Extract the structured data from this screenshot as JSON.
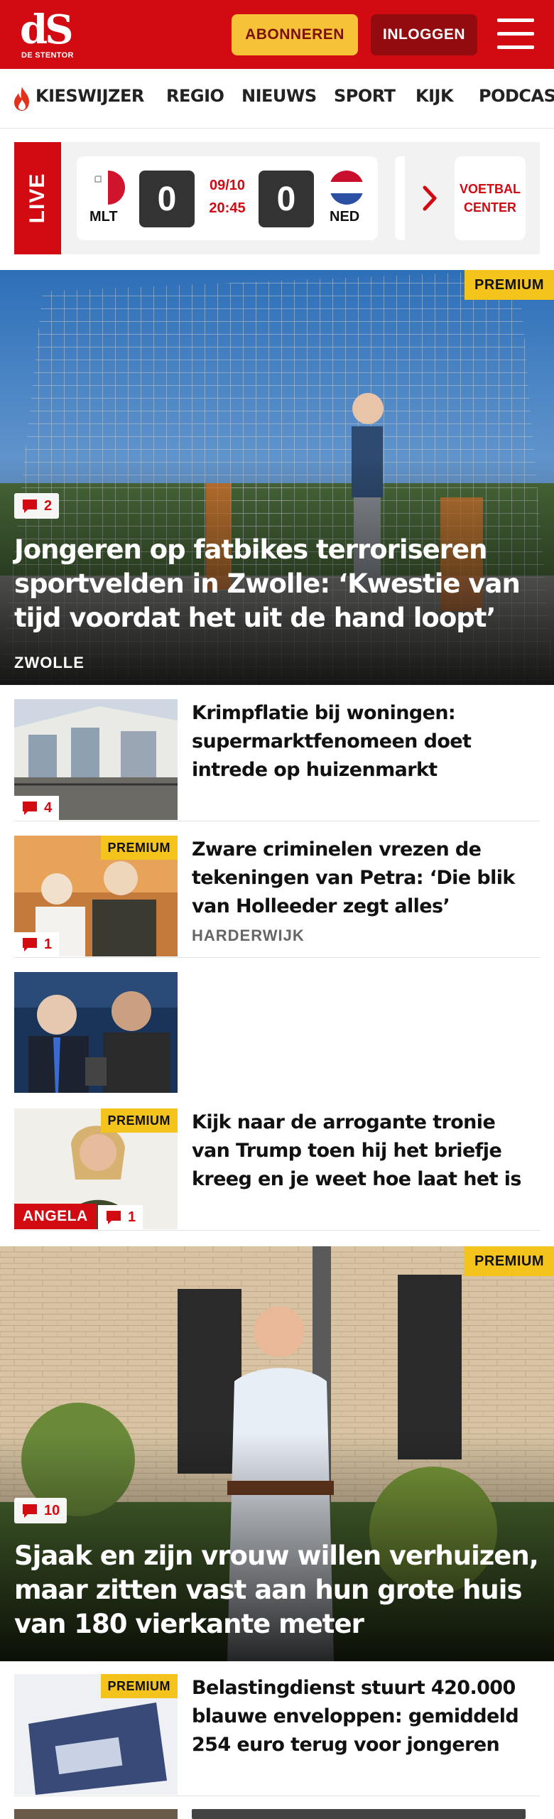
{
  "header": {
    "logo_text": "dS",
    "logo_subtitle": "DE STENTOR",
    "subscribe_label": "ABONNEREN",
    "login_label": "INLOGGEN",
    "menu_icon": "hamburger-menu-icon"
  },
  "nav": {
    "items": [
      "KIESWIJZER",
      "REGIO",
      "NIEUWS",
      "SPORT",
      "KIJK",
      "PODCAST"
    ]
  },
  "live": {
    "label": "LIVE",
    "match": {
      "home_team": "MLT",
      "away_team": "NED",
      "home_score": "0",
      "away_score": "0",
      "date": "09/10",
      "time": "20:45"
    },
    "center_label": "VOETBAL\nCENTER"
  },
  "articles": {
    "hero1": {
      "premium": "PREMIUM",
      "comments": "2",
      "title": "Jongeren op fatbikes terroriseren sportvelden in Zwolle: ‘Kwestie van tijd voordat het uit de hand loopt’",
      "section": "ZWOLLE"
    },
    "item1": {
      "comments": "4",
      "title": "Krimpflatie bij woningen: supermarktfenomeen doet intrede op huizenmarkt"
    },
    "item2": {
      "premium": "PREMIUM",
      "comments": "1",
      "title": "Zware criminelen vrezen de tekeningen van Petra: ‘Die blik van Holleeder zegt alles’",
      "section": "HARDERWIJK"
    },
    "item3": {
      "title": ""
    },
    "item4": {
      "premium": "PREMIUM",
      "author_tag": "ANGELA",
      "comments": "1",
      "title": "Kijk naar de arrogante tronie van Trump toen hij het briefje kreeg en je weet hoe laat het is"
    },
    "hero2": {
      "premium": "PREMIUM",
      "comments": "10",
      "title": "Sjaak en zijn vrouw willen verhuizen, maar zitten vast aan hun grote huis van 180 vierkante meter"
    },
    "item5": {
      "premium": "PREMIUM",
      "title": "Belastingdienst stuurt 420.000 blauwe enveloppen: gemiddeld 254 euro terug voor jongeren"
    }
  },
  "colors": {
    "brand_red": "#d20a11",
    "premium_yellow": "#f4c41c",
    "subscribe_yellow": "#f6c338",
    "login_dark_red": "#930b0f"
  }
}
